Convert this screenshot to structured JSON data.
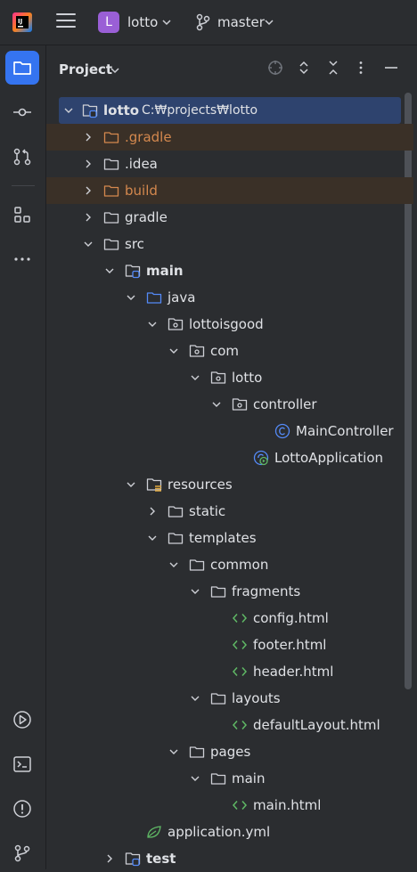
{
  "topbar": {
    "project_badge": "L",
    "project_name": "lotto",
    "branch": "master"
  },
  "panel": {
    "title": "Project"
  },
  "tree": {
    "root_label": "lotto",
    "root_path": "C:₩projects₩lotto",
    "items": [
      {
        "label": ".gradle"
      },
      {
        "label": ".idea"
      },
      {
        "label": "build"
      },
      {
        "label": "gradle"
      },
      {
        "label": "src"
      },
      {
        "label": "main"
      },
      {
        "label": "java"
      },
      {
        "label": "lottoisgood"
      },
      {
        "label": "com"
      },
      {
        "label": "lotto"
      },
      {
        "label": "controller"
      },
      {
        "label": "MainController"
      },
      {
        "label": "LottoApplication"
      },
      {
        "label": "resources"
      },
      {
        "label": "static"
      },
      {
        "label": "templates"
      },
      {
        "label": "common"
      },
      {
        "label": "fragments"
      },
      {
        "label": "config.html"
      },
      {
        "label": "footer.html"
      },
      {
        "label": "header.html"
      },
      {
        "label": "layouts"
      },
      {
        "label": "defaultLayout.html"
      },
      {
        "label": "pages"
      },
      {
        "label": "main"
      },
      {
        "label": "main.html"
      },
      {
        "label": "application.yml"
      },
      {
        "label": "test"
      }
    ]
  },
  "colors": {
    "accent": "#3574f0",
    "folder_excluded": "#d4884e",
    "html_icon": "#5fb865",
    "class_icon": "#548af7"
  }
}
